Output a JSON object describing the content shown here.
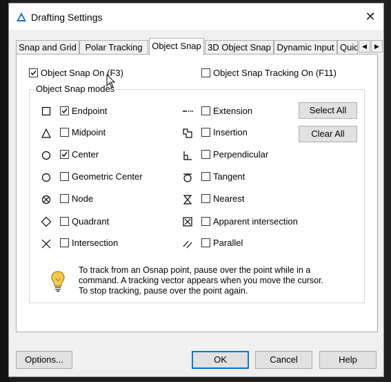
{
  "window": {
    "title": "Drafting Settings",
    "close_glyph": "✕"
  },
  "tabs": [
    {
      "label": "Snap and Grid"
    },
    {
      "label": "Polar Tracking"
    },
    {
      "label": "Object Snap",
      "active": true
    },
    {
      "label": "3D Object Snap"
    },
    {
      "label": "Dynamic Input"
    },
    {
      "label": "Quic"
    }
  ],
  "top_options": {
    "snap_on": {
      "label": "Object Snap On (F3)",
      "checked": true
    },
    "tracking_on": {
      "label": "Object Snap Tracking On (F11)",
      "checked": false
    }
  },
  "modes_group": {
    "title": "Object Snap modes"
  },
  "modes_left": [
    {
      "label": "Endpoint",
      "checked": true,
      "symbol": "square"
    },
    {
      "label": "Midpoint",
      "checked": false,
      "symbol": "triangle"
    },
    {
      "label": "Center",
      "checked": true,
      "symbol": "circle"
    },
    {
      "label": "Geometric Center",
      "checked": false,
      "symbol": "circle"
    },
    {
      "label": "Node",
      "checked": false,
      "symbol": "circle-x"
    },
    {
      "label": "Quadrant",
      "checked": false,
      "symbol": "diamond"
    },
    {
      "label": "Intersection",
      "checked": false,
      "symbol": "x"
    }
  ],
  "modes_right": [
    {
      "label": "Extension",
      "checked": false,
      "symbol": "extension"
    },
    {
      "label": "Insertion",
      "checked": false,
      "symbol": "insertion"
    },
    {
      "label": "Perpendicular",
      "checked": false,
      "symbol": "perpendicular"
    },
    {
      "label": "Tangent",
      "checked": false,
      "symbol": "tangent"
    },
    {
      "label": "Nearest",
      "checked": false,
      "symbol": "hourglass"
    },
    {
      "label": "Apparent intersection",
      "checked": false,
      "symbol": "square-x"
    },
    {
      "label": "Parallel",
      "checked": false,
      "symbol": "parallel"
    }
  ],
  "side_buttons": {
    "select_all": "Select All",
    "clear_all": "Clear All"
  },
  "hint": {
    "icon": "lightbulb-icon",
    "text_line1": "To track from an Osnap point, pause over the point while in a",
    "text_line2": "command.  A tracking vector appears when you move the cursor.",
    "text_line3": "To stop tracking, pause over the point again."
  },
  "footer": {
    "options": "Options...",
    "ok": "OK",
    "cancel": "Cancel",
    "help": "Help"
  },
  "colors": {
    "accent": "#0078d7",
    "bulb": "#f2c94c"
  }
}
